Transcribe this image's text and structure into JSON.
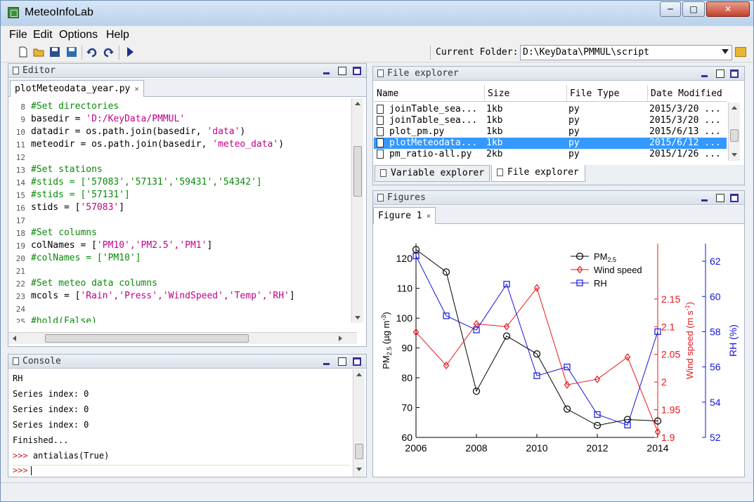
{
  "window": {
    "title": "MeteoInfoLab"
  },
  "menu": [
    "File",
    "Edit",
    "Options",
    "Help"
  ],
  "toolbar": {
    "folder_label": "Current Folder:",
    "folder_path": "D:\\KeyData\\PMMUL\\script"
  },
  "editor": {
    "title": "Editor",
    "tab": "plotMeteodata_year.py",
    "lines": [
      {
        "n": "8",
        "t": "#Set directories",
        "k": "cm"
      },
      {
        "n": "9",
        "parts": [
          {
            "t": "basedir = ",
            "k": "tx"
          },
          {
            "t": "'D:/KeyData/PMMUL'",
            "k": "str"
          }
        ]
      },
      {
        "n": "10",
        "parts": [
          {
            "t": "datadir = os.path.join(basedir, ",
            "k": "tx"
          },
          {
            "t": "'data'",
            "k": "str"
          },
          {
            "t": ")",
            "k": "tx"
          }
        ]
      },
      {
        "n": "11",
        "parts": [
          {
            "t": "meteodir = os.path.join(basedir, ",
            "k": "tx"
          },
          {
            "t": "'meteo_data'",
            "k": "str"
          },
          {
            "t": ")",
            "k": "tx"
          }
        ]
      },
      {
        "n": "12",
        "t": "",
        "k": "tx"
      },
      {
        "n": "13",
        "t": "#Set stations",
        "k": "cm"
      },
      {
        "n": "14",
        "t": "#stids = ['57083','57131','59431','54342']",
        "k": "cm"
      },
      {
        "n": "15",
        "t": "#stids = ['57131']",
        "k": "cm"
      },
      {
        "n": "16",
        "parts": [
          {
            "t": "stids = [",
            "k": "tx"
          },
          {
            "t": "'57083'",
            "k": "str"
          },
          {
            "t": "]",
            "k": "tx"
          }
        ]
      },
      {
        "n": "17",
        "t": "",
        "k": "tx"
      },
      {
        "n": "18",
        "t": "#Set columns",
        "k": "cm"
      },
      {
        "n": "19",
        "parts": [
          {
            "t": "colNames = [",
            "k": "tx"
          },
          {
            "t": "'PM10','PM2.5','PM1'",
            "k": "str"
          },
          {
            "t": "]",
            "k": "tx"
          }
        ]
      },
      {
        "n": "20",
        "t": "#colNames = ['PM10']",
        "k": "cm"
      },
      {
        "n": "21",
        "t": "",
        "k": "tx"
      },
      {
        "n": "22",
        "t": "#Set meteo data columns",
        "k": "cm"
      },
      {
        "n": "23",
        "parts": [
          {
            "t": "mcols = [",
            "k": "tx"
          },
          {
            "t": "'Rain','Press','WindSpeed','Temp','RH'",
            "k": "str"
          },
          {
            "t": "]",
            "k": "tx"
          }
        ]
      },
      {
        "n": "24",
        "t": "",
        "k": "tx"
      },
      {
        "n": "25",
        "t": "#hold(False)",
        "k": "cm"
      }
    ]
  },
  "console": {
    "title": "Console",
    "lines": [
      "RH",
      "Series index: 0",
      "Series index: 0",
      "Series index: 0",
      "Finished..."
    ],
    "prompt": ">>>",
    "last_command": "antialias(True)"
  },
  "file_explorer": {
    "title": "File explorer",
    "columns": [
      "Name",
      "Size",
      "File Type",
      "Date Modified"
    ],
    "rows": [
      [
        "joinTable_sea...",
        "1kb",
        "py",
        "2015/3/20 ..."
      ],
      [
        "joinTable_sea...",
        "1kb",
        "py",
        "2015/3/20 ..."
      ],
      [
        "plot_pm.py",
        "1kb",
        "py",
        "2015/6/13 ..."
      ],
      [
        "plotMeteodata...",
        "1kb",
        "py",
        "2015/6/12 ..."
      ],
      [
        "pm_ratio-all.py",
        "2kb",
        "py",
        "2015/1/26 ..."
      ]
    ],
    "selected_index": 3,
    "bottom_tabs": [
      "Variable explorer",
      "File explorer"
    ]
  },
  "figures": {
    "title": "Figures",
    "tab": "Figure 1"
  },
  "chart_data": {
    "type": "line",
    "x": [
      2006,
      2007,
      2008,
      2009,
      2010,
      2011,
      2012,
      2013,
      2014
    ],
    "xticks": [
      "2006",
      "2008",
      "2010",
      "2012",
      "2014"
    ],
    "xlim": [
      2006,
      2014
    ],
    "series": [
      {
        "name": "PM",
        "name_sub": "2.5",
        "axis": "left",
        "color": "#000000",
        "marker": "circle",
        "values": [
          123,
          115.5,
          75.5,
          94,
          88,
          69.5,
          64,
          66,
          65.5
        ]
      },
      {
        "name": "Wind speed",
        "axis": "right1",
        "color": "#e8161c",
        "marker": "diamond",
        "values": [
          2.09,
          2.03,
          2.105,
          2.1,
          2.17,
          1.995,
          2.005,
          2.045,
          1.91
        ]
      },
      {
        "name": "RH",
        "axis": "right2",
        "color": "#1414e0",
        "marker": "square",
        "values": [
          62.3,
          58.9,
          58.1,
          60.7,
          55.5,
          56.0,
          53.3,
          52.7,
          58.0
        ]
      }
    ],
    "axes": {
      "left": {
        "label": "PM",
        "label_sub": "2.5",
        "label_unit": "(µg m",
        "label_unit_sup": "-3",
        "label_unit_close": ")",
        "ylim": [
          60,
          125
        ],
        "ticks": [
          60,
          70,
          80,
          90,
          100,
          110,
          120
        ],
        "color": "#000000"
      },
      "right1": {
        "label": "Wind speed (m s",
        "label_sup": "-1",
        "label_close": ")",
        "ylim": [
          1.9,
          2.25
        ],
        "ticks": [
          "1.9",
          "1.95",
          "2",
          "2.05",
          "2.1",
          "2.15"
        ],
        "tick_values": [
          1.9,
          1.95,
          2,
          2.05,
          2.1,
          2.15
        ],
        "color": "#e8161c"
      },
      "right2": {
        "label": "RH (%)",
        "ylim": [
          52,
          63
        ],
        "ticks": [
          52,
          54,
          56,
          58,
          60,
          62
        ],
        "color": "#1414e0"
      }
    },
    "legend": "top-right",
    "grid": false
  }
}
